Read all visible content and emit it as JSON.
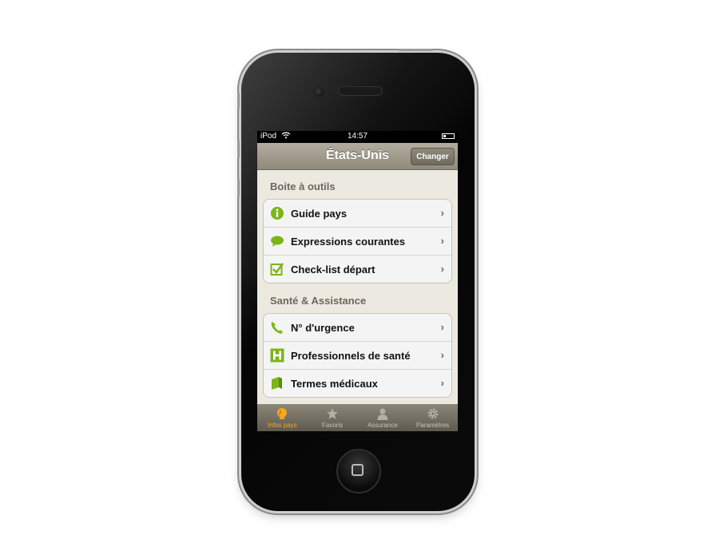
{
  "status_bar": {
    "carrier": "iPod",
    "time": "14:57"
  },
  "nav": {
    "title": "États-Unis",
    "change_button": "Changer"
  },
  "sections": [
    {
      "title": "Boite à outils",
      "items": [
        {
          "label": "Guide pays",
          "icon": "info-icon"
        },
        {
          "label": "Expressions courantes",
          "icon": "speech-bubble-icon"
        },
        {
          "label": "Check-list départ",
          "icon": "checkbox-icon"
        }
      ]
    },
    {
      "title": "Santé & Assistance",
      "items": [
        {
          "label": "N° d'urgence",
          "icon": "phone-icon"
        },
        {
          "label": "Professionnels de santé",
          "icon": "hospital-icon"
        },
        {
          "label": "Termes médicaux",
          "icon": "book-icon"
        }
      ]
    }
  ],
  "tabs": [
    {
      "label": "Infos pays",
      "icon": "globe-icon",
      "active": true
    },
    {
      "label": "Favoris",
      "icon": "star-icon",
      "active": false
    },
    {
      "label": "Assurance",
      "icon": "person-icon",
      "active": false
    },
    {
      "label": "Paramètres",
      "icon": "gear-icon",
      "active": false
    }
  ],
  "colors": {
    "accent_green": "#7cb518",
    "active_tab": "#f7a821",
    "nav_bar": "#a39e90"
  }
}
